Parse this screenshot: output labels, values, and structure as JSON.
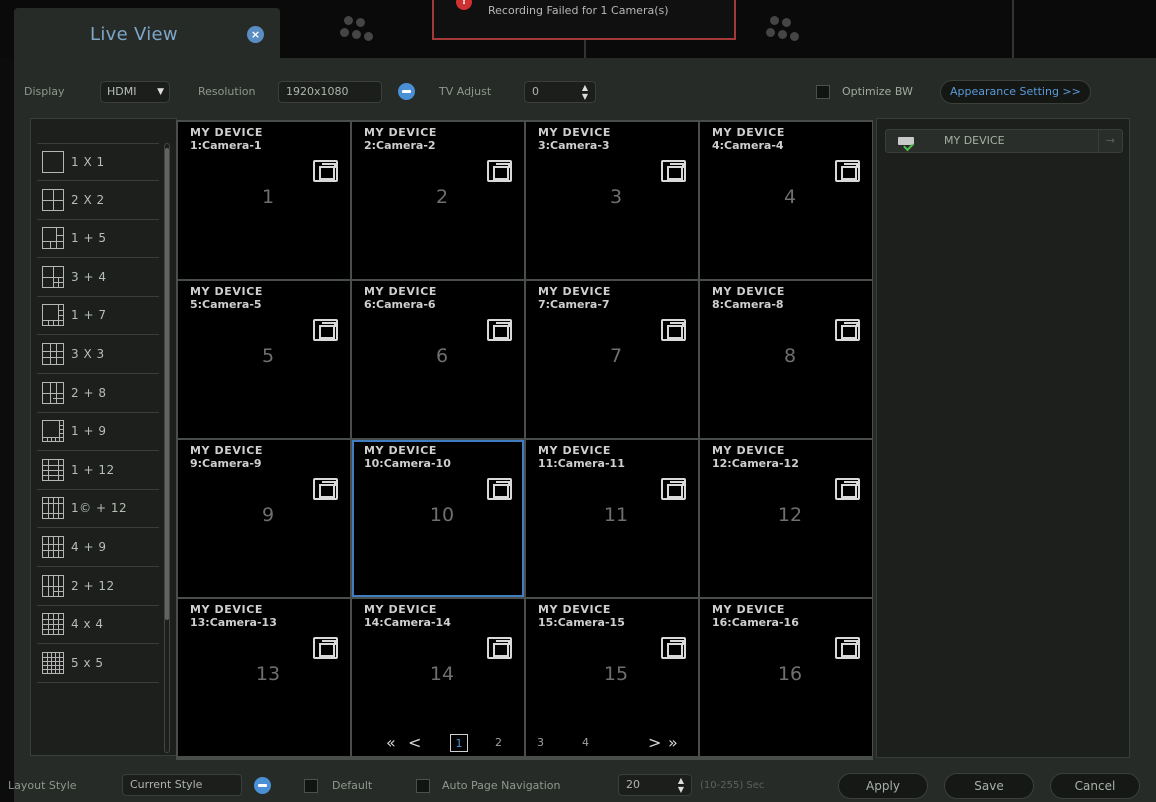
{
  "tab": {
    "title": "Live View"
  },
  "alert": {
    "message": "Recording Failed for 1 Camera(s)"
  },
  "toolbar": {
    "display_label": "Display",
    "display_value": "HDMI",
    "resolution_label": "Resolution",
    "resolution_value": "1920x1080",
    "tv_adjust_label": "TV Adjust",
    "tv_adjust_value": "0",
    "optimize_bw_label": "Optimize BW",
    "appearance_button": "Appearance Setting >>"
  },
  "layouts": [
    {
      "label": "1 X 1",
      "icon": "layout-1x1-icon"
    },
    {
      "label": "2 X 2",
      "icon": "layout-2x2-icon"
    },
    {
      "label": "1 + 5",
      "icon": "layout-1p5-icon"
    },
    {
      "label": "3 + 4",
      "icon": "layout-3p4-icon"
    },
    {
      "label": "1 + 7",
      "icon": "layout-1p7-icon"
    },
    {
      "label": "3 X 3",
      "icon": "layout-3x3-icon"
    },
    {
      "label": "2 + 8",
      "icon": "layout-2p8-icon"
    },
    {
      "label": "1 + 9",
      "icon": "layout-1p9-icon"
    },
    {
      "label": "1 + 12",
      "icon": "layout-1p12-icon"
    },
    {
      "label": "1© + 12",
      "icon": "layout-1cp12-icon"
    },
    {
      "label": "4 + 9",
      "icon": "layout-4p9-icon"
    },
    {
      "label": "2 + 12",
      "icon": "layout-2p12-icon"
    },
    {
      "label": "4 x 4",
      "icon": "layout-4x4-icon"
    },
    {
      "label": "5 x 5",
      "icon": "layout-5x5-icon"
    }
  ],
  "cells": [
    {
      "device": "MY DEVICE",
      "camera": "1:Camera-1",
      "number": "1"
    },
    {
      "device": "MY DEVICE",
      "camera": "2:Camera-2",
      "number": "2"
    },
    {
      "device": "MY DEVICE",
      "camera": "3:Camera-3",
      "number": "3"
    },
    {
      "device": "MY DEVICE",
      "camera": "4:Camera-4",
      "number": "4"
    },
    {
      "device": "MY DEVICE",
      "camera": "5:Camera-5",
      "number": "5"
    },
    {
      "device": "MY DEVICE",
      "camera": "6:Camera-6",
      "number": "6"
    },
    {
      "device": "MY DEVICE",
      "camera": "7:Camera-7",
      "number": "7"
    },
    {
      "device": "MY DEVICE",
      "camera": "8:Camera-8",
      "number": "8"
    },
    {
      "device": "MY DEVICE",
      "camera": "9:Camera-9",
      "number": "9"
    },
    {
      "device": "MY DEVICE",
      "camera": "10:Camera-10",
      "number": "10"
    },
    {
      "device": "MY DEVICE",
      "camera": "11:Camera-11",
      "number": "11"
    },
    {
      "device": "MY DEVICE",
      "camera": "12:Camera-12",
      "number": "12"
    },
    {
      "device": "MY DEVICE",
      "camera": "13:Camera-13",
      "number": "13"
    },
    {
      "device": "MY DEVICE",
      "camera": "14:Camera-14",
      "number": "14"
    },
    {
      "device": "MY DEVICE",
      "camera": "15:Camera-15",
      "number": "15"
    },
    {
      "device": "MY DEVICE",
      "camera": "16:Camera-16",
      "number": "16"
    }
  ],
  "selected_cell": 10,
  "pager": {
    "first": "«",
    "prev": "<",
    "next": ">",
    "last": "»",
    "pages": [
      "1",
      "2",
      "3",
      "4"
    ],
    "current": "1"
  },
  "device_list": {
    "name": "MY DEVICE",
    "arrow": "→"
  },
  "bottom": {
    "layout_style_label": "Layout Style",
    "layout_style_value": "Current Style",
    "default_label": "Default",
    "auto_page_label": "Auto Page Navigation",
    "auto_page_value": "20",
    "range_hint": "(10-255) Sec",
    "apply": "Apply",
    "save": "Save",
    "cancel": "Cancel"
  },
  "colors": {
    "accent": "#4a90d4",
    "panel": "#272b27",
    "alert_border": "#a33a3a"
  }
}
